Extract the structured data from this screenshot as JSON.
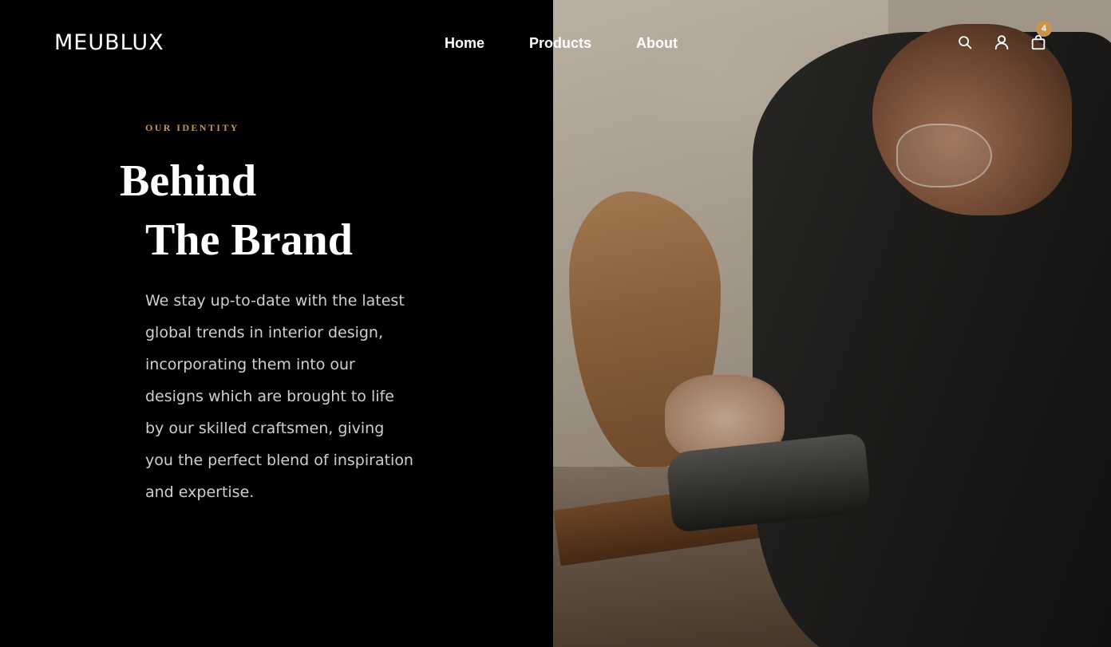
{
  "brand": {
    "logo": "MEUBLUX"
  },
  "nav": {
    "items": [
      "Home",
      "Products",
      "About"
    ]
  },
  "header_icons": {
    "search": "search-icon",
    "account": "user-icon",
    "cart": "shopping-bag-icon",
    "cart_count": "4"
  },
  "hero": {
    "eyebrow": "OUR IDENTITY",
    "title_line1": "Behind",
    "title_line2": "The Brand",
    "lines": [
      "We stay up-to-date with the latest",
      "global trends in interior design,",
      "incorporating them into our",
      "designs which are brought to life",
      "by our skilled craftsmen, giving",
      "you the perfect blend of inspiration",
      "and expertise."
    ]
  },
  "colors": {
    "background": "#000000",
    "accent": "#c8944f",
    "text": "#ffffff",
    "body_text": "#cfcfcf"
  }
}
